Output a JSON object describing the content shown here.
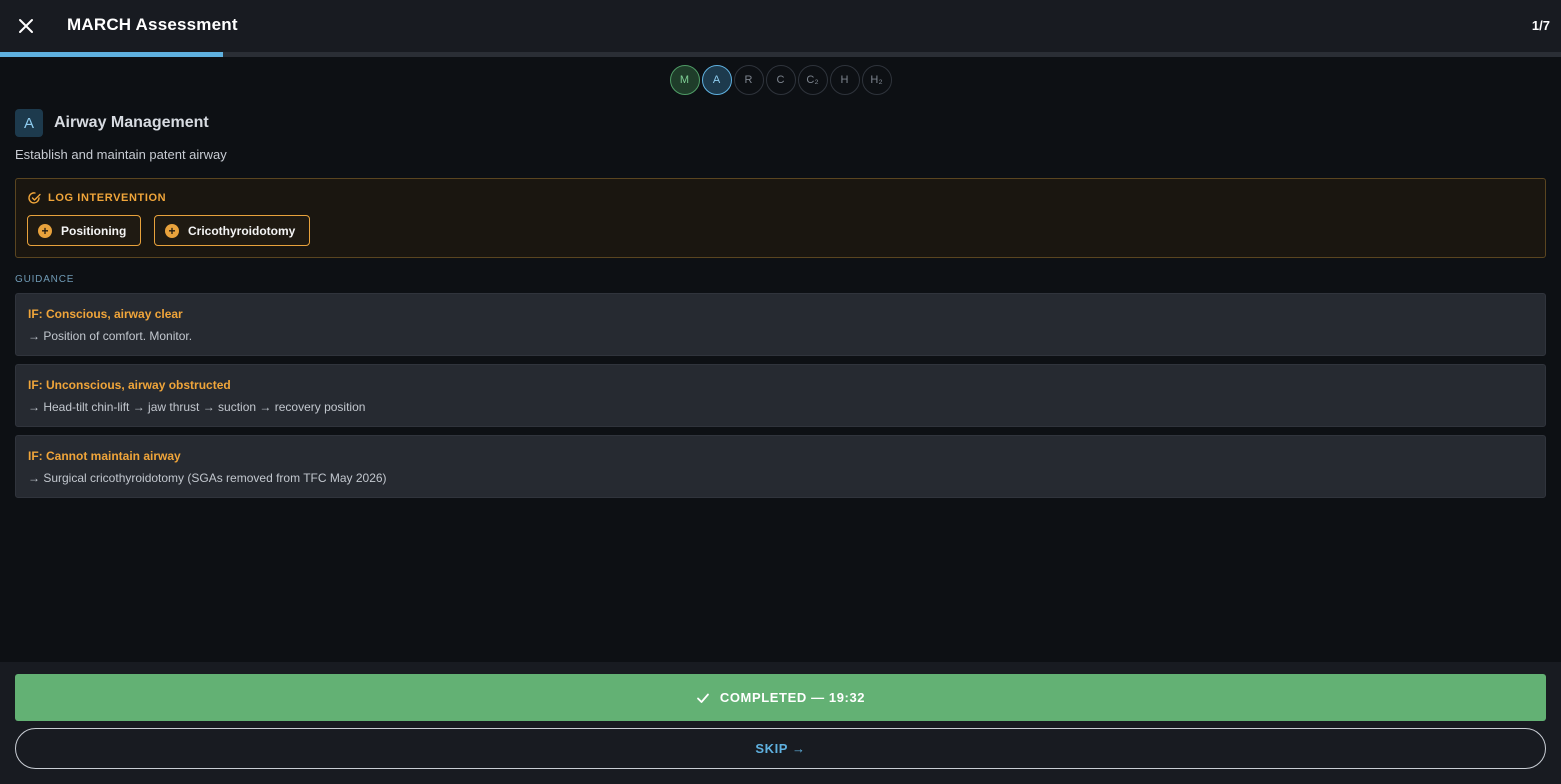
{
  "header": {
    "title": "MARCH Assessment",
    "step_count": "1/7",
    "progress_fraction": 0.143
  },
  "steps": [
    {
      "label": "M",
      "state": "done"
    },
    {
      "label": "A",
      "state": "active"
    },
    {
      "label": "R",
      "state": "pending"
    },
    {
      "label": "C",
      "state": "pending"
    },
    {
      "label": "C₂",
      "state": "pending"
    },
    {
      "label": "H",
      "state": "pending"
    },
    {
      "label": "H₂",
      "state": "pending"
    }
  ],
  "section": {
    "letter": "A",
    "title": "Airway Management",
    "description": "Establish and maintain patent airway"
  },
  "intervention": {
    "label": "LOG INTERVENTION",
    "buttons": [
      "Positioning",
      "Cricothyroidotomy"
    ]
  },
  "guidance": {
    "label": "GUIDANCE",
    "items": [
      {
        "condition": "IF: Conscious, airway clear",
        "action": "→ Position of comfort. Monitor."
      },
      {
        "condition": "IF: Unconscious, airway obstructed",
        "action": "→ Head-tilt chin-lift → jaw thrust → suction → recovery position"
      },
      {
        "condition": "IF: Cannot maintain airway",
        "action": "→ Surgical cricothyroidotomy (SGAs removed from TFC May 2026)"
      }
    ]
  },
  "footer": {
    "complete_label": "COMPLETED — 19:32",
    "skip_label": "SKIP →"
  },
  "colors": {
    "accent_blue": "#5fb1e0",
    "accent_orange": "#f0a53a",
    "complete_green": "#63b174"
  }
}
